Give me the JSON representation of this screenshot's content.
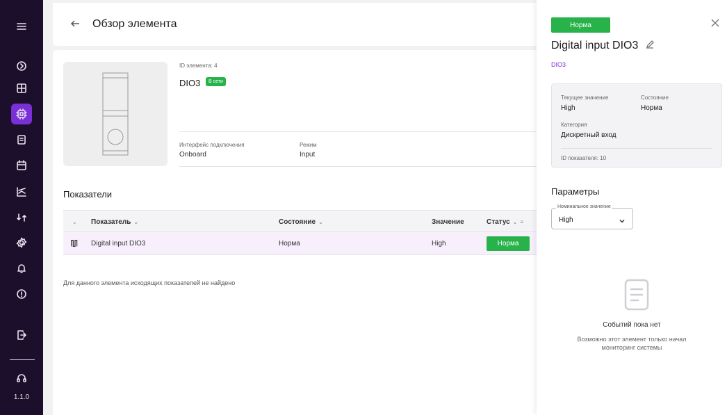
{
  "app": {
    "version": "1.1.0"
  },
  "sidebar": {
    "items": [
      {
        "icon": "menu-icon"
      },
      {
        "icon": "dashboard-icon"
      },
      {
        "icon": "grid-icon"
      },
      {
        "icon": "chip-icon",
        "active": true
      },
      {
        "icon": "document-icon"
      },
      {
        "icon": "calendar-icon"
      },
      {
        "icon": "chart-icon"
      },
      {
        "icon": "sync-icon"
      },
      {
        "icon": "settings-icon"
      },
      {
        "icon": "bell-icon"
      },
      {
        "icon": "info-icon"
      },
      {
        "icon": "logout-icon"
      },
      {
        "icon": "headset-icon"
      }
    ],
    "accent": "#7b2fd6",
    "background": "#1c0f2b"
  },
  "header": {
    "title": "Обзор элемента"
  },
  "element": {
    "id_label": "ID элемента: 4",
    "name": "DIO3",
    "online_badge": "В сети",
    "fields": [
      {
        "label": "Интерфейс подключения",
        "value": "Onboard"
      },
      {
        "label": "Режим",
        "value": "Input"
      }
    ]
  },
  "indicators": {
    "title": "Показатели",
    "columns": [
      "Показатель",
      "Состояние",
      "Значение",
      "Статус"
    ],
    "rows": [
      {
        "name": "Digital input DIO3",
        "state": "Норма",
        "value": "High",
        "status": "Норма"
      }
    ],
    "empty_outgoing": "Для данного элемента исходящих показателей не найдено"
  },
  "panel": {
    "status_badge": "Норма",
    "title": "Digital input DIO3",
    "subtitle": "DIO3",
    "card": {
      "current_value_label": "Текущее значение",
      "current_value": "High",
      "state_label": "Состояние",
      "state_value": "Норма",
      "category_label": "Категория",
      "category_value": "Дискретный вход",
      "indicator_id": "ID показателя: 10"
    },
    "params_title": "Параметры",
    "nominal": {
      "legend": "Номинальное значение",
      "value": "High"
    },
    "events_empty_title": "Событий пока нет",
    "events_empty_sub": "Возможно этот элемент только начал мониторинг системы"
  },
  "colors": {
    "status_ok": "#27b34a",
    "link": "#7b2fd6"
  }
}
